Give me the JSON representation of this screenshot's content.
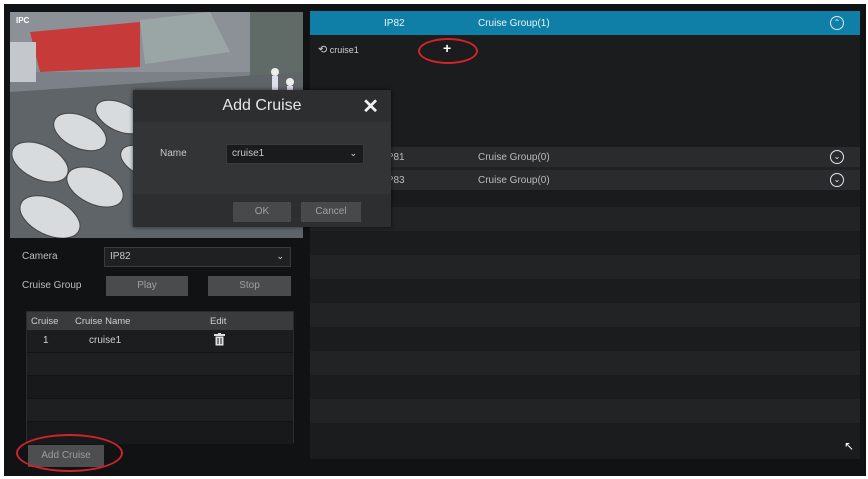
{
  "preview": {
    "camera_label": "IPC"
  },
  "camera": {
    "label": "Camera",
    "value": "IP82"
  },
  "cruise_group": {
    "label": "Cruise Group",
    "play_label": "Play",
    "stop_label": "Stop"
  },
  "table": {
    "headers": [
      "Cruise",
      "Cruise Name",
      "Edit"
    ],
    "rows": [
      {
        "index": "1",
        "name": "cruise1"
      }
    ]
  },
  "add_cruise_label": "Add Cruise",
  "groups": [
    {
      "camera": "IP82",
      "name": "Cruise Group(1)",
      "expanded": true,
      "cruise": "cruise1",
      "add": "+"
    },
    {
      "camera": "IP81",
      "name": "Cruise Group(0)",
      "expanded": false
    },
    {
      "camera": "IP83",
      "name": "Cruise Group(0)",
      "expanded": false
    }
  ],
  "dialog": {
    "title": "Add Cruise",
    "close": "✕",
    "name_label": "Name",
    "name_value": "cruise1",
    "ok_label": "OK",
    "cancel_label": "Cancel"
  },
  "icons": {
    "expand_up": "⌃",
    "expand_down": "⌄",
    "trash": "trash-icon",
    "cruise": "refresh-icon"
  },
  "colors": {
    "accent": "#0f7fa8",
    "highlight": "#d2232a"
  }
}
